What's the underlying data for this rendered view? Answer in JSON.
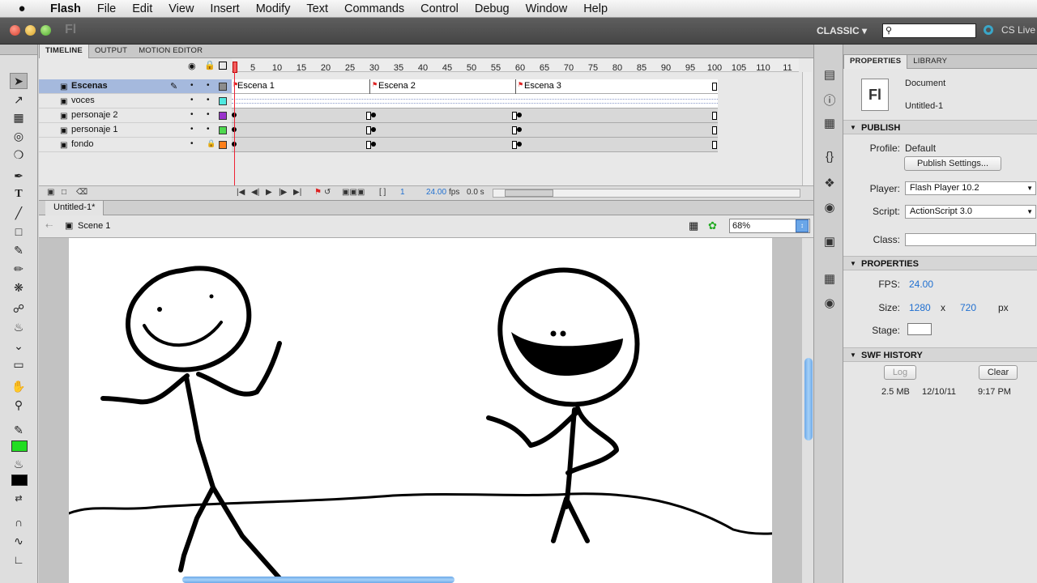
{
  "menubar": {
    "app_name": "Flash",
    "items": [
      "File",
      "Edit",
      "View",
      "Insert",
      "Modify",
      "Text",
      "Commands",
      "Control",
      "Debug",
      "Window",
      "Help"
    ]
  },
  "appbar": {
    "logo": "Fl",
    "workspace": "CLASSIC ▾",
    "search_placeholder": "",
    "cs_live": "CS Live"
  },
  "timeline": {
    "tabs": [
      "TIMELINE",
      "OUTPUT",
      "MOTION EDITOR"
    ],
    "ruler": [
      "5",
      "10",
      "15",
      "20",
      "25",
      "30",
      "35",
      "40",
      "45",
      "50",
      "55",
      "60",
      "65",
      "70",
      "75",
      "80",
      "85",
      "90",
      "95",
      "100",
      "105",
      "110",
      "11"
    ],
    "layers": [
      {
        "name": "Escenas"
      },
      {
        "name": "voces"
      },
      {
        "name": "personaje 2"
      },
      {
        "name": "personaje 1"
      },
      {
        "name": "fondo"
      }
    ],
    "frame_labels": [
      "Escena 1",
      "Escena 2",
      "Escena 3"
    ],
    "footer": {
      "frame": "1",
      "fps": "24.00",
      "fps_unit": "fps",
      "time": "0.0 s"
    }
  },
  "document": {
    "tab": "Untitled-1*",
    "scene": "Scene 1",
    "zoom": "68%"
  },
  "properties": {
    "tabs": [
      "PROPERTIES",
      "LIBRARY"
    ],
    "doc_icon": "Fl",
    "doc_type": "Document",
    "doc_name": "Untitled-1",
    "publish": {
      "title": "PUBLISH",
      "profile_label": "Profile:",
      "profile_value": "Default",
      "publish_settings": "Publish Settings...",
      "player_label": "Player:",
      "player_value": "Flash Player 10.2",
      "script_label": "Script:",
      "script_value": "ActionScript 3.0",
      "class_label": "Class:"
    },
    "props": {
      "title": "PROPERTIES",
      "fps_label": "FPS:",
      "fps_value": "24.00",
      "size_label": "Size:",
      "width": "1280",
      "x": "x",
      "height": "720",
      "unit": "px",
      "stage_label": "Stage:"
    },
    "swf": {
      "title": "SWF HISTORY",
      "log": "Log",
      "clear": "Clear",
      "size": "2.5 MB",
      "date": "12/10/11",
      "time": "9:17 PM"
    }
  },
  "colors": {
    "layer_escenas": "#8c8c8c",
    "layer_voces": "#4fe8e0",
    "layer_personaje2": "#9933cc",
    "layer_personaje1": "#4fd84f",
    "layer_fondo": "#ff7f1a",
    "fill_color": "#22dd22",
    "stroke_color": "#000000"
  }
}
